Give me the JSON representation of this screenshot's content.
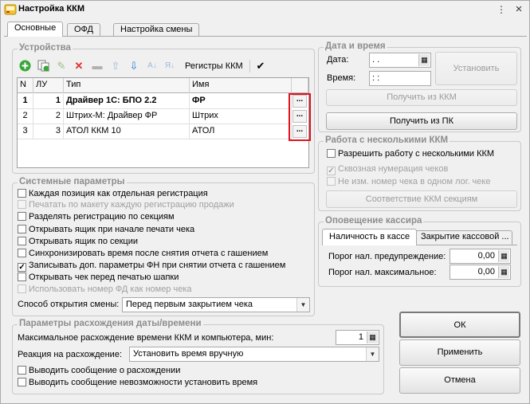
{
  "window": {
    "title": "Настройка ККМ",
    "close_glyph": "×"
  },
  "tabs": [
    "Основные",
    "ОФД",
    "Настройка смены"
  ],
  "devices": {
    "group_title": "Устройства",
    "toolbar_registers_label": "Регистры ККМ",
    "columns": [
      "N",
      "ЛУ",
      "Тип",
      "Имя"
    ],
    "rows": [
      {
        "n": "1",
        "lu": "1",
        "type": "Драйвер 1С: БПО 2.2",
        "name": "ФР",
        "bold": true
      },
      {
        "n": "2",
        "lu": "2",
        "type": "Штрих-М: Драйвер ФР",
        "name": "Штрих",
        "bold": false
      },
      {
        "n": "3",
        "lu": "3",
        "type": "АТОЛ ККМ 10",
        "name": "АТОЛ",
        "bold": false
      }
    ],
    "row_button_label": "..."
  },
  "system": {
    "group_title": "Системные параметры",
    "options": [
      {
        "label": "Каждая позиция как отдельная регистрация",
        "checked": false,
        "enabled": true
      },
      {
        "label": "Печатать по макету каждую регистрацию продажи",
        "checked": false,
        "enabled": false
      },
      {
        "label": "Разделять регистрацию по секциям",
        "checked": false,
        "enabled": true
      },
      {
        "label": "Открывать ящик при начале печати чека",
        "checked": false,
        "enabled": true
      },
      {
        "label": "Открывать ящик по секции",
        "checked": false,
        "enabled": true
      },
      {
        "label": "Синхронизировать время после снятия отчета с гашением",
        "checked": false,
        "enabled": true
      },
      {
        "label": "Записывать доп. параметры ФН при снятии отчета с гашением",
        "checked": true,
        "enabled": true
      },
      {
        "label": "Открывать чек перед печатью шапки",
        "checked": false,
        "enabled": true
      },
      {
        "label": "Использовать номер ФД как номер чека",
        "checked": false,
        "enabled": false
      }
    ],
    "shift_open_label": "Способ открытия смены:",
    "shift_open_value": "Перед первым закрытием чека"
  },
  "datetime": {
    "group_title": "Дата и время",
    "date_label": "Дата:",
    "date_value": " .  .",
    "time_label": "Время:",
    "time_value": " :  :",
    "set_button": "Установить",
    "get_kkm_button": "Получить из ККМ",
    "get_pc_button": "Получить из ПК"
  },
  "multi": {
    "group_title": "Работа с несколькими ККМ",
    "allow_label": "Разрешить работу с несколькими ККМ",
    "through_label": "Сквозная нумерация чеков",
    "same_label": "Не изм. номер чека в одном лог. чеке",
    "sections_button": "Соответствие ККМ секциям"
  },
  "cashier": {
    "group_title": "Оповещение кассира",
    "tabs": [
      "Наличность в кассе",
      "Закрытие кассовой ..."
    ],
    "warn_label": "Порог нал. предупреждение:",
    "warn_value": "0,00",
    "max_label": "Порог нал. максимальное:",
    "max_value": "0,00"
  },
  "discrepancy": {
    "group_title": "Параметры расхождения даты/времени",
    "max_label": "Максимальное расхождение времени ККМ и компьютера, мин:",
    "max_value": "1",
    "reaction_label": "Реакция на расхождение:",
    "reaction_value": "Установить время вручную",
    "show_msg_label": "Выводить сообщение о расхождении",
    "show_fail_label": "Выводить сообщение невозможности установить время"
  },
  "actions": {
    "ok": "ОК",
    "apply": "Применить",
    "cancel": "Отмена"
  }
}
